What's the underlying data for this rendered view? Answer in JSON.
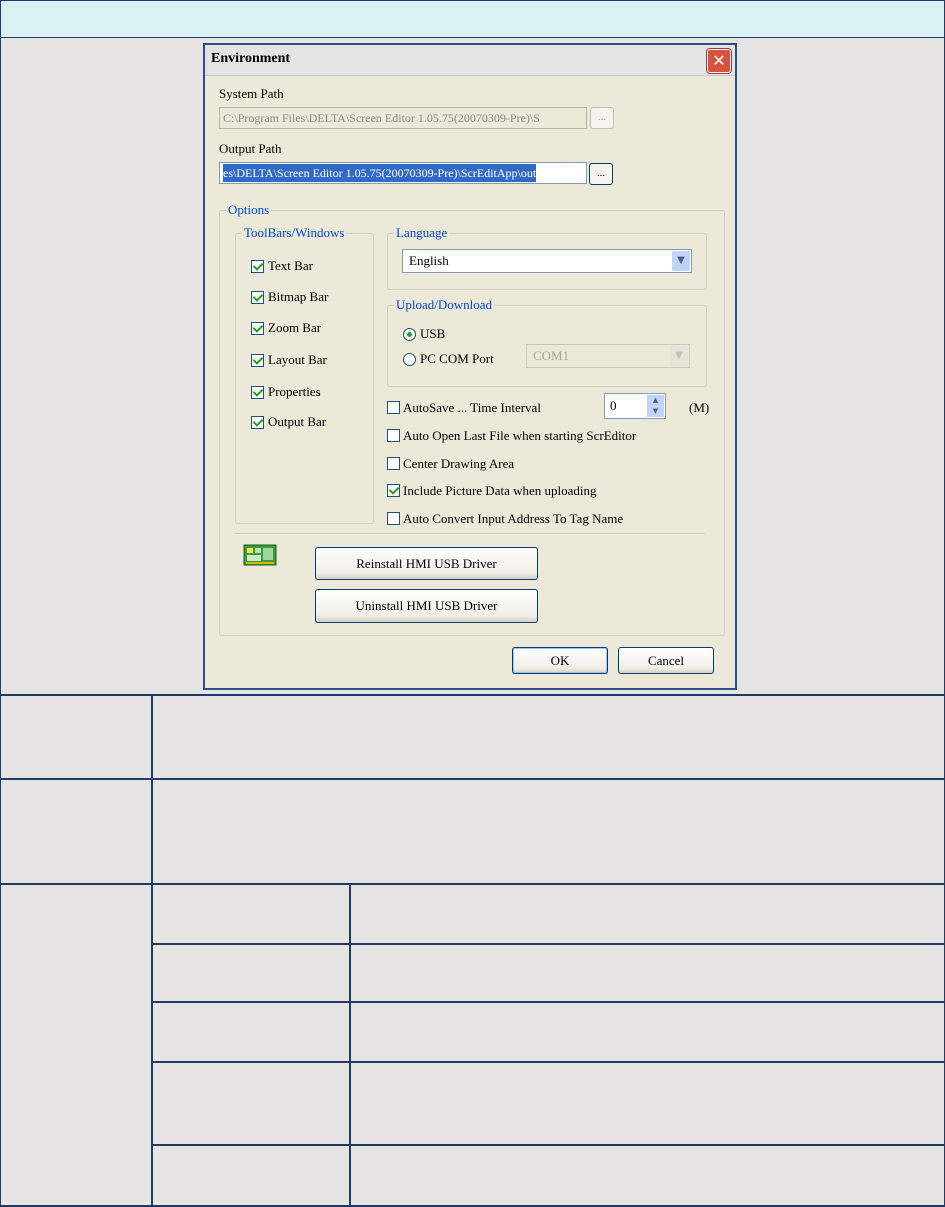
{
  "dialog": {
    "title": "Environment",
    "close_glyph": "✕",
    "system_path": {
      "label": "System Path",
      "value": "C:\\Program Files\\DELTA\\Screen Editor 1.05.75(20070309-Pre)\\S",
      "browse_label": "..."
    },
    "output_path": {
      "label": "Output Path",
      "value": "es\\DELTA\\Screen Editor 1.05.75(20070309-Pre)\\ScrEditApp\\out",
      "browse_label": "..."
    },
    "options": {
      "title": "Options",
      "toolbars": {
        "title": "ToolBars/Windows",
        "items": [
          {
            "label": "Text Bar",
            "checked": true
          },
          {
            "label": "Bitmap Bar",
            "checked": true
          },
          {
            "label": "Zoom Bar",
            "checked": true
          },
          {
            "label": "Layout Bar",
            "checked": true
          },
          {
            "label": "Properties",
            "checked": true
          },
          {
            "label": "Output Bar",
            "checked": true
          }
        ]
      },
      "language": {
        "title": "Language",
        "selected": "English"
      },
      "upload_download": {
        "title": "Upload/Download",
        "usb_label": "USB",
        "usb_selected": true,
        "com_label": "PC COM Port",
        "com_value": "COM1"
      },
      "autosave": {
        "label": "AutoSave ...  Time Interval",
        "value": "0",
        "unit": "(M)",
        "checked": false
      },
      "checks": [
        {
          "label": "Auto Open Last File when starting ScrEditor",
          "checked": false
        },
        {
          "label": "Center Drawing Area",
          "checked": false
        },
        {
          "label": "Include Picture Data when uploading",
          "checked": true
        },
        {
          "label": "Auto Convert Input Address To Tag Name",
          "checked": false
        }
      ],
      "reinstall_label": "Reinstall HMI USB Driver",
      "uninstall_label": "Uninstall HMI USB Driver"
    },
    "ok_label": "OK",
    "cancel_label": "Cancel"
  }
}
